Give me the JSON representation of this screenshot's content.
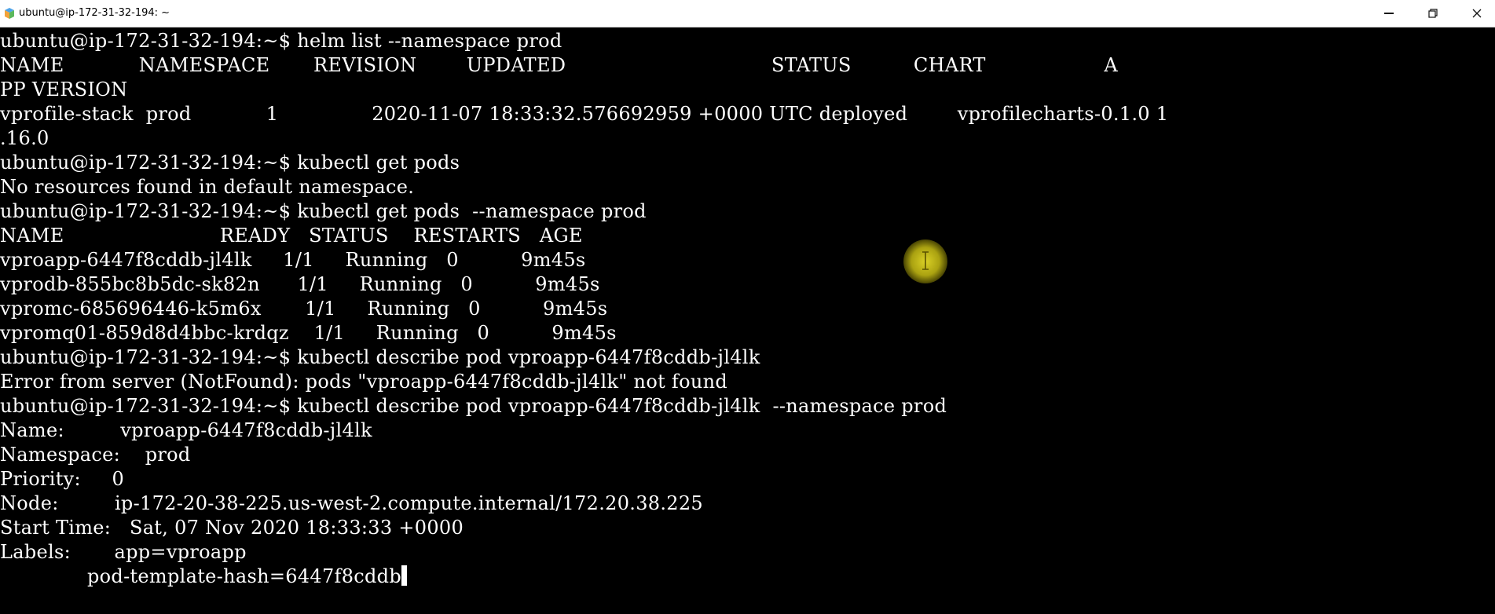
{
  "window": {
    "title": "ubuntu@ip-172-31-32-194: ~",
    "icons": {
      "app": "terminal-app-icon",
      "minimize": "minimize-icon",
      "maximize": "restore-icon",
      "close": "close-icon"
    }
  },
  "terminal": {
    "lines": [
      "ubuntu@ip-172-31-32-194:~$ helm list --namespace prod",
      "NAME            NAMESPACE       REVISION        UPDATED                                 STATUS          CHART                   A",
      "PP VERSION",
      "vprofile-stack  prod            1               2020-11-07 18:33:32.576692959 +0000 UTC deployed        vprofilecharts-0.1.0 1",
      ".16.0",
      "ubuntu@ip-172-31-32-194:~$ kubectl get pods",
      "No resources found in default namespace.",
      "ubuntu@ip-172-31-32-194:~$ kubectl get pods  --namespace prod",
      "NAME                         READY   STATUS    RESTARTS   AGE",
      "vproapp-6447f8cddb-jl4lk     1/1     Running   0          9m45s",
      "vprodb-855bc8b5dc-sk82n      1/1     Running   0          9m45s",
      "vpromc-685696446-k5m6x       1/1     Running   0          9m45s",
      "vpromq01-859d8d4bbc-krdqz    1/1     Running   0          9m45s",
      "ubuntu@ip-172-31-32-194:~$ kubectl describe pod vproapp-6447f8cddb-jl4lk",
      "Error from server (NotFound): pods \"vproapp-6447f8cddb-jl4lk\" not found",
      "ubuntu@ip-172-31-32-194:~$ kubectl describe pod vproapp-6447f8cddb-jl4lk  --namespace prod",
      "Name:         vproapp-6447f8cddb-jl4lk",
      "Namespace:    prod",
      "Priority:     0",
      "Node:         ip-172-20-38-225.us-west-2.compute.internal/172.20.38.225",
      "Start Time:   Sat, 07 Nov 2020 18:33:33 +0000",
      "Labels:       app=vproapp",
      "              pod-template-hash=6447f8cddb"
    ]
  },
  "colors": {
    "terminal_bg": "#000000",
    "terminal_fg": "#ffffff",
    "titlebar_bg": "#ffffff",
    "mouse_highlight": "#d8cc1c"
  }
}
